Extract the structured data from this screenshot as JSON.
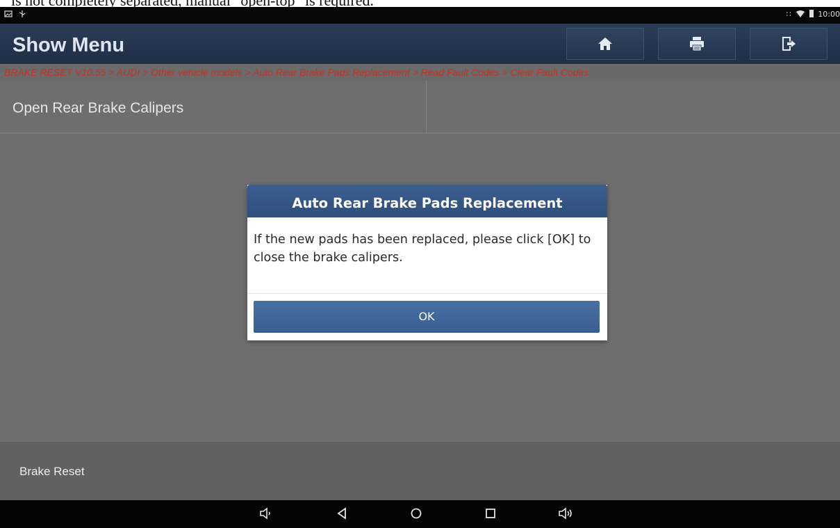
{
  "document_caption": "is not completely separated, manual \"open-top\" is required.",
  "status_bar": {
    "left_icons": [
      "image-icon",
      "usb-icon"
    ],
    "right_icons": [
      "bluetooth-icon",
      "wifi-icon",
      "battery-icon"
    ],
    "time": "10:00"
  },
  "header": {
    "title": "Show Menu",
    "buttons": [
      "home-icon",
      "print-icon",
      "exit-icon"
    ]
  },
  "breadcrumb": "BRAKE RESET V10.55 > AUDI > Other vehicle models > Auto Rear Brake Pads Replacement > Read Fault Codes > Clear Fault Codes",
  "menu_items": [
    "Open Rear Brake Calipers"
  ],
  "dialog": {
    "title": "Auto Rear Brake Pads Replacement",
    "message": "If the new pads has been replaced, please click [OK] to close the brake calipers.",
    "ok_label": "OK"
  },
  "footer": {
    "label": "Brake Reset"
  },
  "nav_bar": [
    "volume-down-icon",
    "back-icon",
    "home-circle-icon",
    "recents-icon",
    "volume-up-icon"
  ],
  "colors": {
    "title_bar": "#263750",
    "breadcrumb_text": "#c43325",
    "dialog_header": "#365785",
    "ok_button": "#3f6598",
    "background": "#6e6e6e"
  }
}
